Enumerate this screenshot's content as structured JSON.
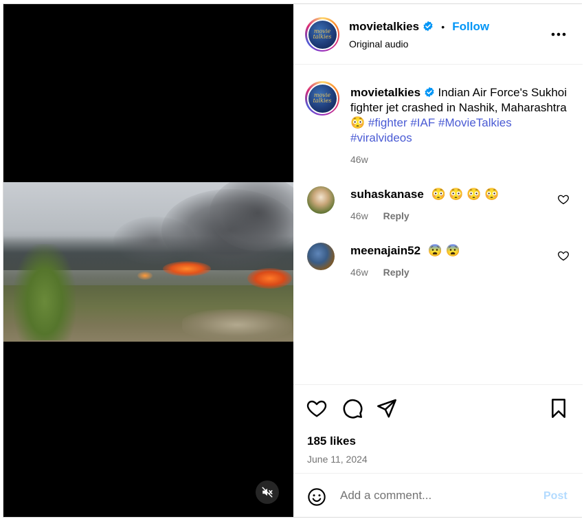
{
  "post": {
    "author": "movietalkies",
    "follow_label": "Follow",
    "separator": "•",
    "audio": "Original audio",
    "avatar_text_line1": "movie",
    "avatar_text_line2": "talkies"
  },
  "caption": {
    "author": "movietalkies",
    "text": "Indian Air Force's Sukhoi fighter jet crashed in Nashik, Maharashtra",
    "emoji": "😳",
    "hashtags": [
      "#fighter",
      "#IAF",
      "#MovieTalkies",
      "#viralvideos"
    ],
    "age": "46w"
  },
  "comments": [
    {
      "user": "suhaskanase",
      "text": "😳 😳 😳 😳",
      "age": "46w",
      "reply_label": "Reply"
    },
    {
      "user": "meenajain52",
      "text": "😨 😨",
      "age": "46w",
      "reply_label": "Reply"
    }
  ],
  "engagement": {
    "likes": "185 likes",
    "date": "June 11, 2024"
  },
  "comment_box": {
    "placeholder": "Add a comment...",
    "post_label": "Post"
  },
  "icons": {
    "verified": "verified-badge-icon",
    "more": "more-options-icon",
    "like": "heart-icon",
    "comment": "comment-icon",
    "share": "share-icon",
    "save": "bookmark-icon",
    "emoji": "emoji-icon",
    "mute": "muted-speaker-icon"
  },
  "colors": {
    "accent": "#0095f6",
    "hashtag": "#4a5bd4",
    "muted_text": "#737373",
    "post_disabled": "#b3dbff"
  }
}
